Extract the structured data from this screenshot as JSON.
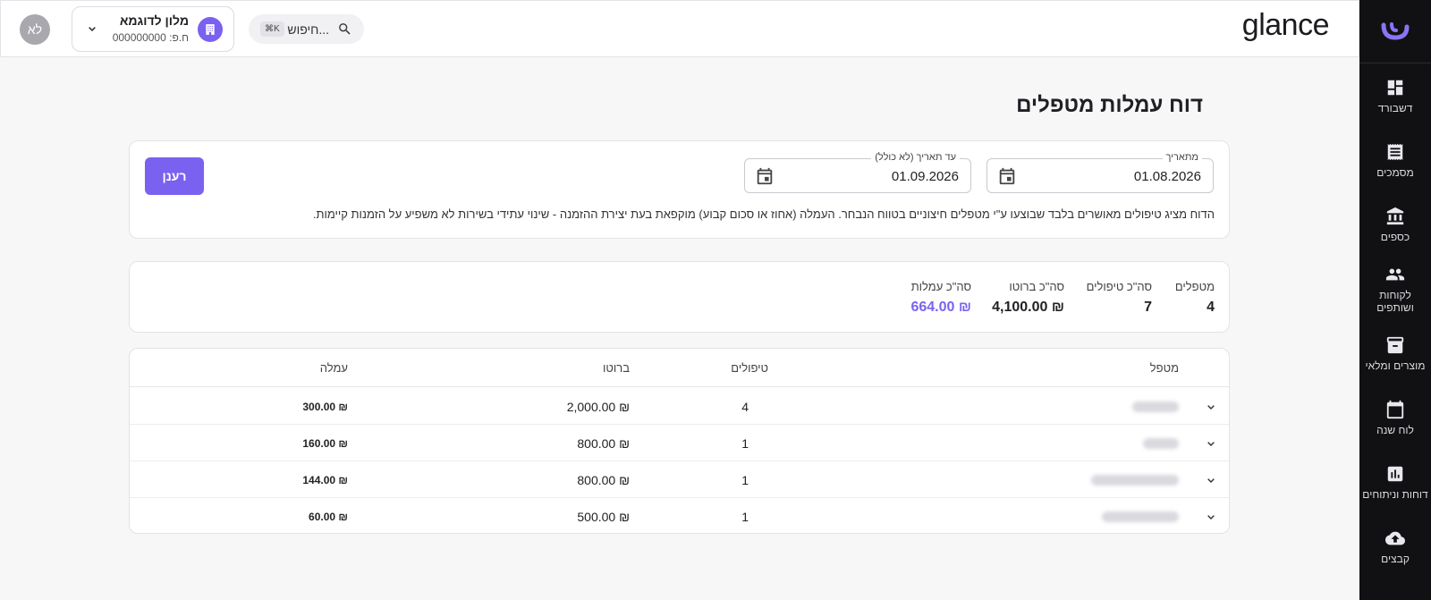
{
  "app": {
    "brand": "glance"
  },
  "sidebar": {
    "items": [
      {
        "label": "דשבורד",
        "icon": "dashboard-icon"
      },
      {
        "label": "מסמכים",
        "icon": "receipt-icon"
      },
      {
        "label": "כספים",
        "icon": "bank-icon"
      },
      {
        "label": "לקוחות ושותפים",
        "icon": "people-icon"
      },
      {
        "label": "מוצרים ומלאי",
        "icon": "inventory-icon"
      },
      {
        "label": "לוח שנה",
        "icon": "calendar-icon"
      },
      {
        "label": "דוחות וניתוחים",
        "icon": "chart-icon"
      },
      {
        "label": "קבצים",
        "icon": "cloud-upload-icon"
      }
    ]
  },
  "header": {
    "avatar": "לא",
    "tenant": {
      "name": "מלון לדוגמא",
      "phone": "ח.פ: 000000000"
    },
    "search": {
      "placeholder": "חיפוש...",
      "shortcut": "⌘K"
    }
  },
  "page": {
    "title": "דוח עמלות מטפלים"
  },
  "filters": {
    "from": {
      "label": "מתאריך",
      "value": "01.08.2026"
    },
    "to": {
      "label": "עד תאריך (לא כולל)",
      "value": "01.09.2026"
    },
    "refresh_label": "רענן",
    "note": "הדוח מציג טיפולים מאושרים בלבד שבוצעו ע\"י מטפלים חיצוניים בטווח הנבחר. העמלה (אחוז או סכום קבוע) מוקפאת בעת יצירת ההזמנה - שינוי עתידי בשירות לא משפיע על הזמנות קיימות."
  },
  "summary": {
    "therapists": {
      "label": "מטפלים",
      "value": "4"
    },
    "treatments": {
      "label": "סה\"כ טיפולים",
      "value": "7"
    },
    "gross": {
      "label": "סה\"כ ברוטו",
      "value": "₪ 4,100.00"
    },
    "commission": {
      "label": "סה\"כ עמלות",
      "value": "₪ 664.00"
    }
  },
  "colors": {
    "accent": "#7b61f0",
    "sidebar_bg": "#111114"
  },
  "table": {
    "headers": {
      "therapist": "מטפל",
      "treatments": "טיפולים",
      "gross": "ברוטו",
      "commission": "עמלה"
    },
    "rows": [
      {
        "treatments": "4",
        "gross": "₪ 2,000.00",
        "commission": "₪ 300.00"
      },
      {
        "treatments": "1",
        "gross": "₪ 800.00",
        "commission": "₪ 160.00"
      },
      {
        "treatments": "1",
        "gross": "₪ 800.00",
        "commission": "₪ 144.00"
      },
      {
        "treatments": "1",
        "gross": "₪ 500.00",
        "commission": "₪ 60.00"
      }
    ]
  }
}
